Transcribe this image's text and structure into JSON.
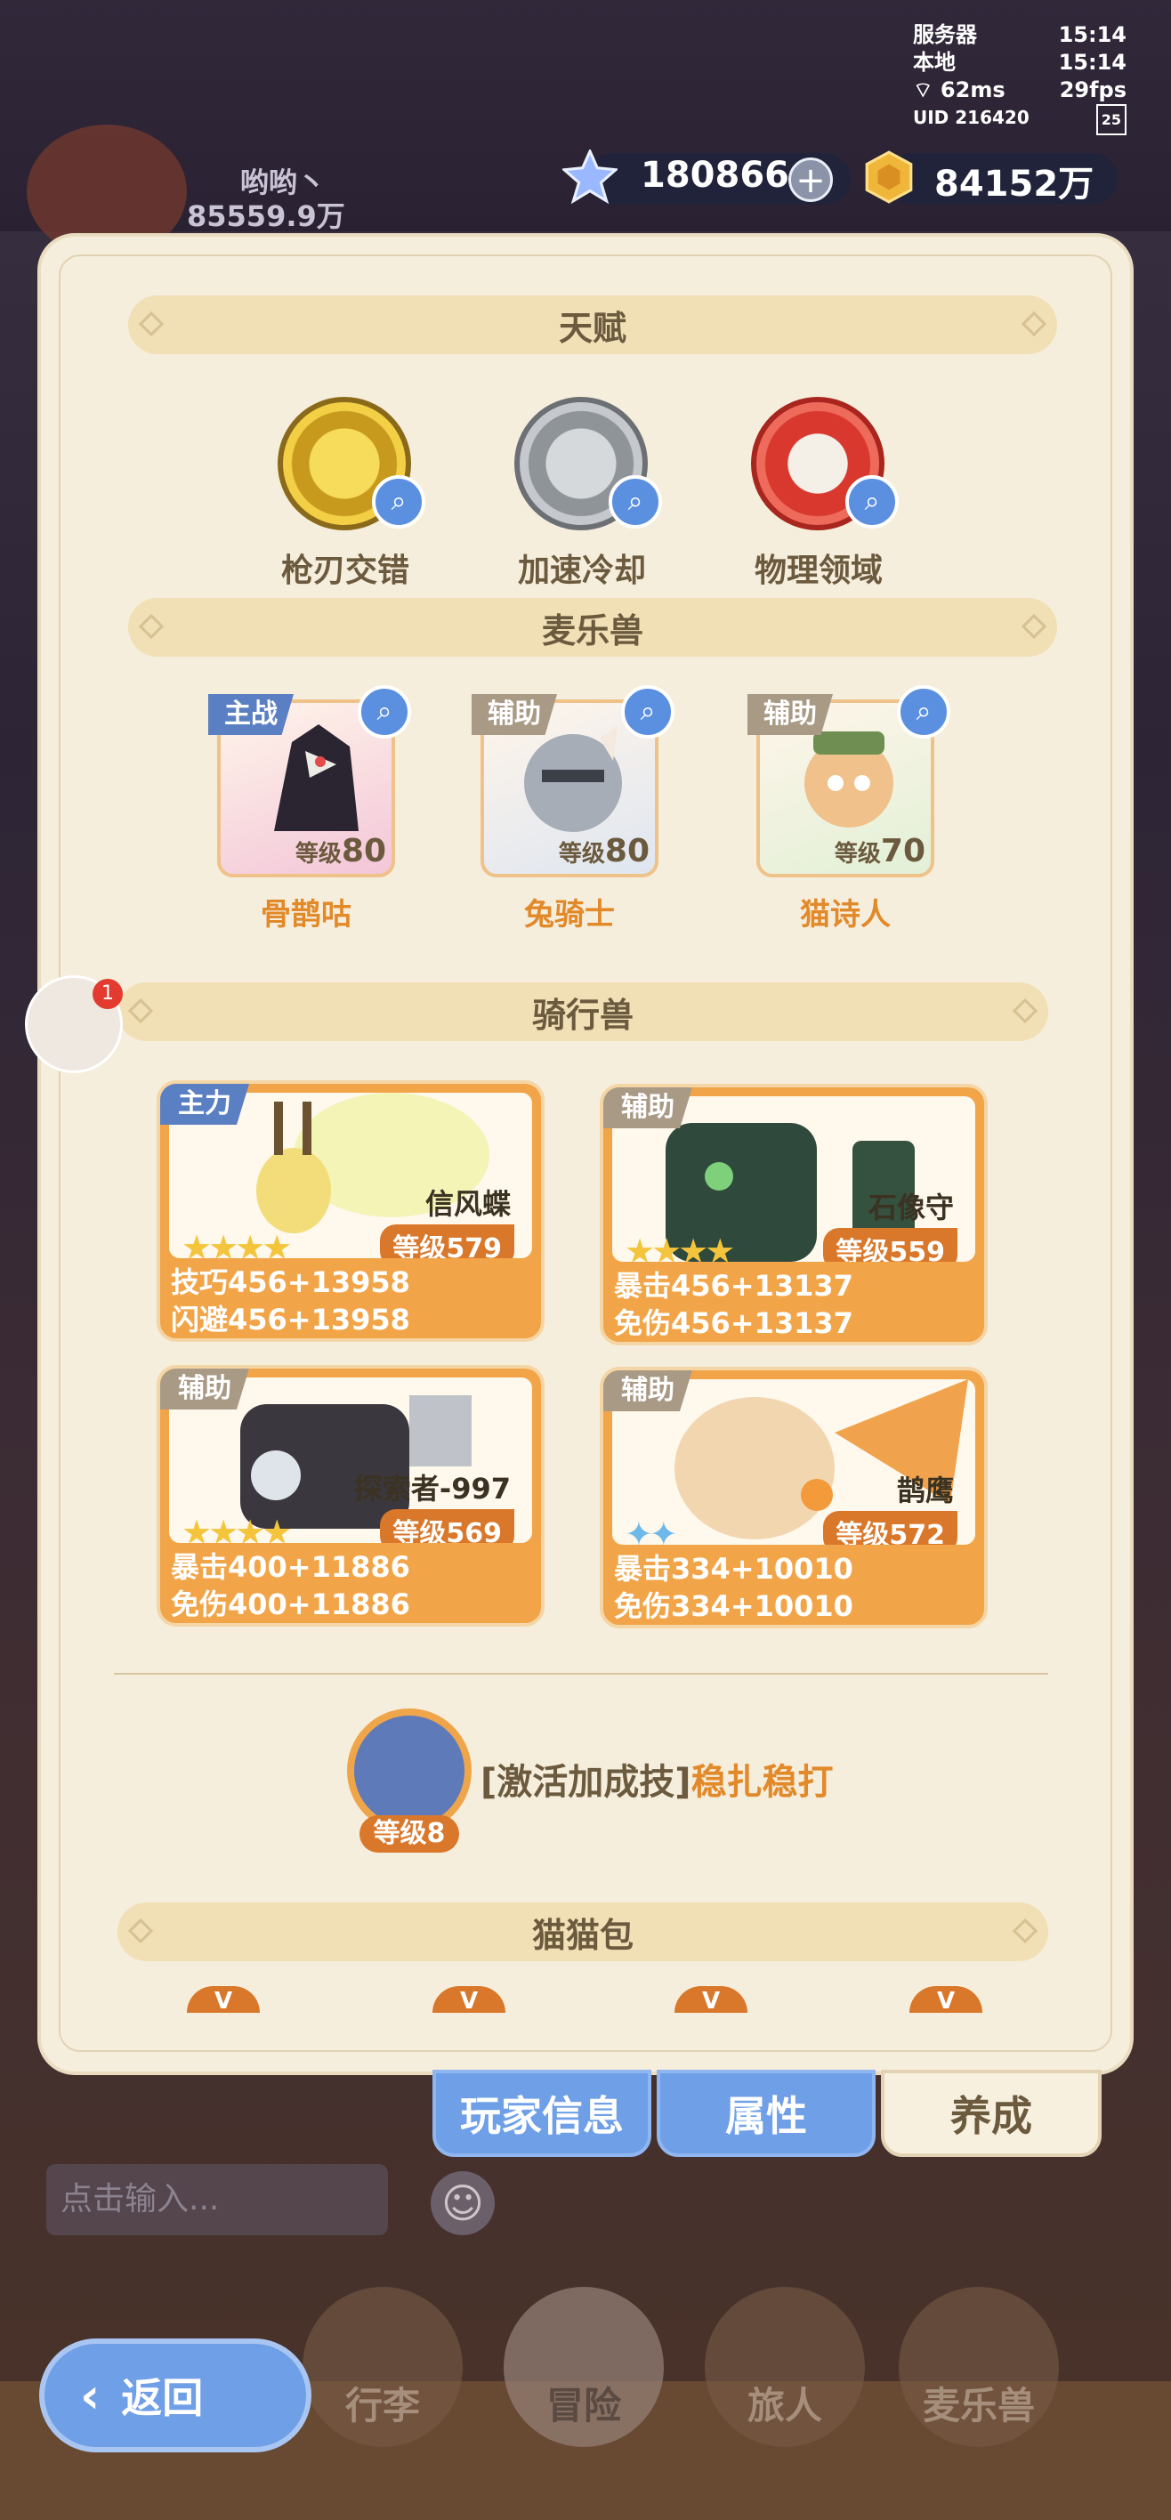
{
  "status": {
    "server_label": "服务器",
    "server_time": "15:14",
    "local_label": "本地",
    "local_time": "15:14",
    "ping": "62ms",
    "fps": "29fps",
    "uid": "UID 216420",
    "battery": "25"
  },
  "player": {
    "name": "哟哟丶",
    "power": "85559.9万"
  },
  "currency": {
    "gems": "180866",
    "gold": "84152万"
  },
  "sections": {
    "talent": "天赋",
    "pets": "麦乐兽",
    "mounts": "骑行兽",
    "catbag": "猫猫包"
  },
  "talents": [
    {
      "name": "枪刃交错",
      "icon": "sun-gear-icon",
      "color": "#e8c33a"
    },
    {
      "name": "加速冷却",
      "icon": "stone-hand-icon",
      "color": "#a9adb3"
    },
    {
      "name": "物理领域",
      "icon": "red-seal-icon",
      "color": "#e2463b"
    }
  ],
  "pets": [
    {
      "role": "主战",
      "level_prefix": "等级",
      "level": "80",
      "name": "骨鹊咕"
    },
    {
      "role": "辅助",
      "level_prefix": "等级",
      "level": "80",
      "name": "兔骑士"
    },
    {
      "role": "辅助",
      "level_prefix": "等级",
      "level": "70",
      "name": "猫诗人"
    }
  ],
  "mounts": [
    {
      "role": "主力",
      "name": "信风蝶",
      "level": "等级579",
      "stat1": "技巧456+13958",
      "stat2": "闪避456+13958",
      "stars": "★★★★"
    },
    {
      "role": "辅助",
      "name": "石像守",
      "level": "等级559",
      "stat1": "暴击456+13137",
      "stat2": "免伤456+13137",
      "stars": "★★★★"
    },
    {
      "role": "辅助",
      "name": "探索者-997",
      "level": "等级569",
      "stat1": "暴击400+11886",
      "stat2": "免伤400+11886",
      "stars": "★★★★"
    },
    {
      "role": "辅助",
      "name": "鹊鹰",
      "level": "等级572",
      "stat1": "暴击334+10010",
      "stat2": "免伤334+10010",
      "stars": "✦✦"
    }
  ],
  "skill": {
    "level": "等级8",
    "prefix": "[激活加成技]",
    "name": "稳扎稳打"
  },
  "catbag_marks": [
    "V",
    "V",
    "V",
    "V"
  ],
  "tabs": {
    "player_info": "玩家信息",
    "attributes": "属性",
    "cultivate": "养成"
  },
  "chat": {
    "placeholder": "点击输入...",
    "badge": "1"
  },
  "nav": {
    "inventory": "行李",
    "adventure": "冒险",
    "travelers": "旅人",
    "pets": "麦乐兽",
    "back": "返回"
  }
}
